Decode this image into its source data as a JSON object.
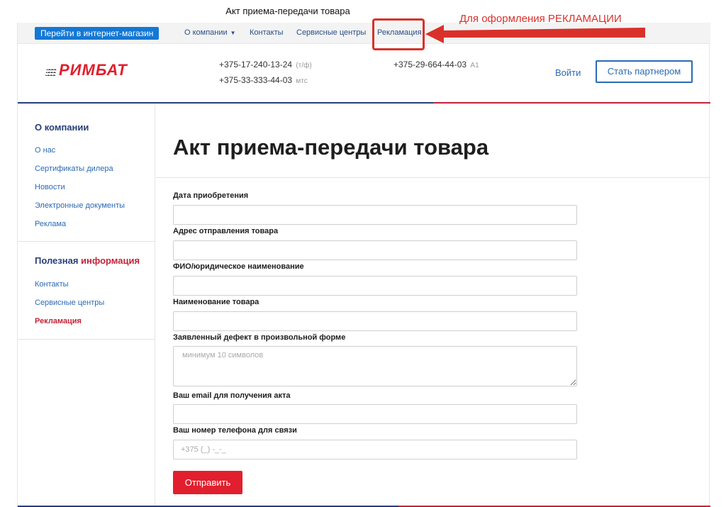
{
  "window": {
    "title": "Акт приема-передачи товара"
  },
  "annotation": {
    "text": "Для оформления РЕКЛАМАЦИИ"
  },
  "topnav": {
    "shop_button": "Перейти в интернет-магазин",
    "items": [
      "О компании",
      "Контакты",
      "Сервисные центры",
      "Рекламация"
    ]
  },
  "header": {
    "logo": "РИМБАТ",
    "phones": [
      {
        "number": "+375-17-240-13-24",
        "tag": "(т/ф)"
      },
      {
        "number": "+375-33-333-44-03",
        "tag": "мтс"
      },
      {
        "number": "+375-29-664-44-03",
        "tag": "А1"
      }
    ],
    "login": "Войти",
    "partner_button": "Стать партнером"
  },
  "sidebar": {
    "group1": {
      "title": "О компании",
      "items": [
        "О нас",
        "Сертификаты дилера",
        "Новости",
        "Электронные документы",
        "Реклама"
      ]
    },
    "group2": {
      "title_a": "Полезная ",
      "title_b": "информация",
      "items": [
        "Контакты",
        "Сервисные центры",
        "Рекламация"
      ]
    }
  },
  "content": {
    "title": "Акт приема-передачи товара",
    "fields": [
      {
        "label": "Дата приобретения",
        "value": "",
        "placeholder": ""
      },
      {
        "label": "Адрес отправления товара",
        "value": "",
        "placeholder": ""
      },
      {
        "label": "ФИО/юридическое наименование",
        "value": "",
        "placeholder": ""
      },
      {
        "label": "Наименование товара",
        "value": "",
        "placeholder": ""
      },
      {
        "label": "Заявленный дефект в произвольной форме",
        "value": "",
        "placeholder": "минимум 10 символов"
      },
      {
        "label": "Ваш email для получения акта",
        "value": "",
        "placeholder": ""
      },
      {
        "label": "Ваш номер телефона для связи",
        "value": "",
        "placeholder": "+375 (_) -_-_"
      }
    ],
    "submit": "Отправить"
  },
  "colors": {
    "brand_red": "#e11f2e",
    "nav_blue": "#1478d4",
    "link_blue": "#2a6ab5",
    "dark_blue": "#283e7a",
    "annotation_red": "#d9312a"
  }
}
